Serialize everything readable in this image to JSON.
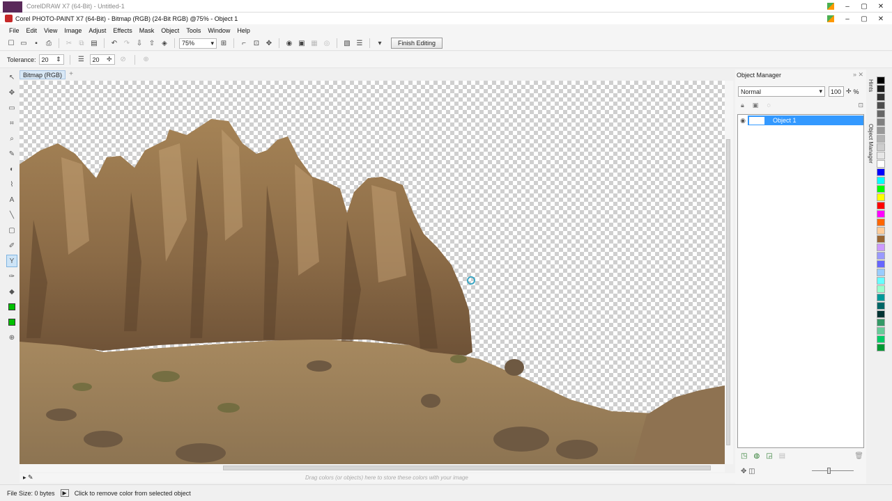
{
  "background_window": {
    "title": "CorelDRAW X7 (64-Bit) - Untitled-1"
  },
  "titlebar": {
    "title": "Corel PHOTO-PAINT X7 (64-Bit) - Bitmap (RGB) (24-Bit RGB) @75% - Object 1"
  },
  "menu": [
    "File",
    "Edit",
    "View",
    "Image",
    "Adjust",
    "Effects",
    "Mask",
    "Object",
    "Tools",
    "Window",
    "Help"
  ],
  "toolbar": {
    "zoom": "75%",
    "finish_editing": "Finish Editing"
  },
  "propbar": {
    "tolerance_label": "Tolerance:",
    "tolerance_value": "20",
    "second_value": "20"
  },
  "document_tab": "Bitmap (RGB)",
  "docker": {
    "title": "Object Manager",
    "blend_mode": "Normal",
    "opacity": "100",
    "opacity_unit": "%",
    "objects": [
      {
        "name": "Object 1"
      }
    ]
  },
  "side_tabs": {
    "hints": "Hints",
    "object_manager": "Object Manager"
  },
  "colorbar_hint": "Drag colors (or objects) here to store these colors with your image",
  "status": {
    "file_size": "File Size: 0 bytes",
    "message": "Click to remove color from selected object"
  },
  "colors": {
    "selection": "#3399ff",
    "primary_fill": "#00c000",
    "outline": "#000000"
  },
  "palette": [
    "#000000",
    "#1a1a1a",
    "#333333",
    "#4d4d4d",
    "#666666",
    "#808080",
    "#999999",
    "#b3b3b3",
    "#cccccc",
    "#e6e6e6",
    "#ffffff",
    "#0000ff",
    "#00ffff",
    "#00ff00",
    "#ffff00",
    "#ff0000",
    "#ff00ff",
    "#ff6600",
    "#ffcc99",
    "#996633",
    "#cc99ff",
    "#9999ff",
    "#6666ff",
    "#99ccff",
    "#66ffff",
    "#99ffcc",
    "#009999",
    "#006666",
    "#003333",
    "#339966",
    "#66cc99",
    "#00cc66",
    "#009933"
  ]
}
